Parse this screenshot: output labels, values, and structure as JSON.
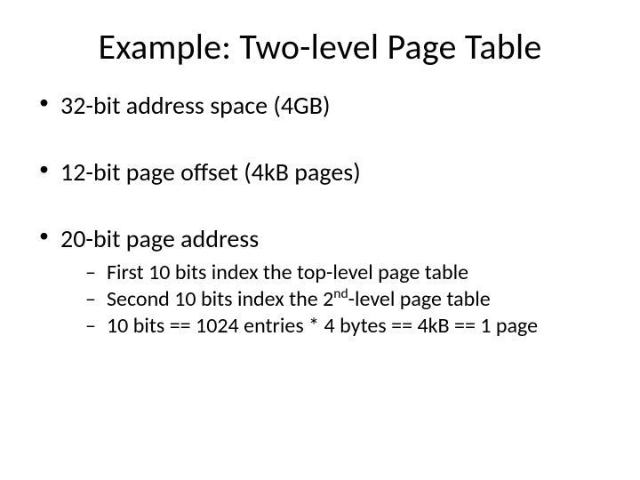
{
  "title": "Example: Two-level Page Table",
  "bullets": {
    "b1": "32-bit address space (4GB)",
    "b2": "12-bit page offset (4kB pages)",
    "b3": "20-bit page address",
    "b3_sub": {
      "s1": "First 10 bits index the top-level page table",
      "s2_pre": "Second 10 bits index the 2",
      "s2_sup": "nd",
      "s2_post": "-level page table",
      "s3": "10 bits == 1024 entries * 4 bytes == 4kB == 1 page"
    }
  }
}
